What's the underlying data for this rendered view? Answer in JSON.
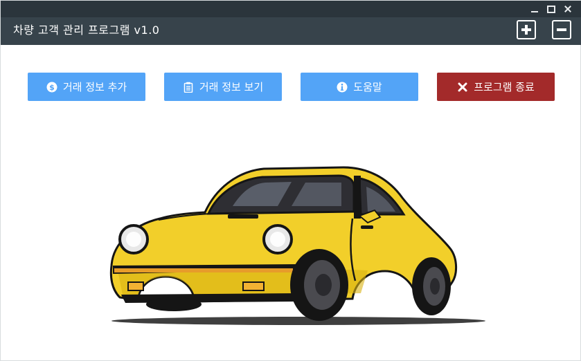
{
  "window": {
    "title": "차량 고객 관리 프로그램 v1.0"
  },
  "header": {
    "add_icon": "plus-box-icon",
    "remove_icon": "minus-box-icon"
  },
  "toolbar": {
    "add_label": "거래 정보 추가",
    "view_label": "거래 정보 보기",
    "help_label": "도움말",
    "exit_label": "프로그램 종료"
  },
  "icons": {
    "add": "dollar-circle-icon",
    "view": "clipboard-icon",
    "help": "info-circle-icon",
    "exit": "close-x-icon"
  },
  "colors": {
    "titlebar": "#2b353c",
    "header": "#37434b",
    "primary_button": "#53a4f7",
    "danger_button": "#a32a2a",
    "car_body": "#f2cf2a"
  }
}
